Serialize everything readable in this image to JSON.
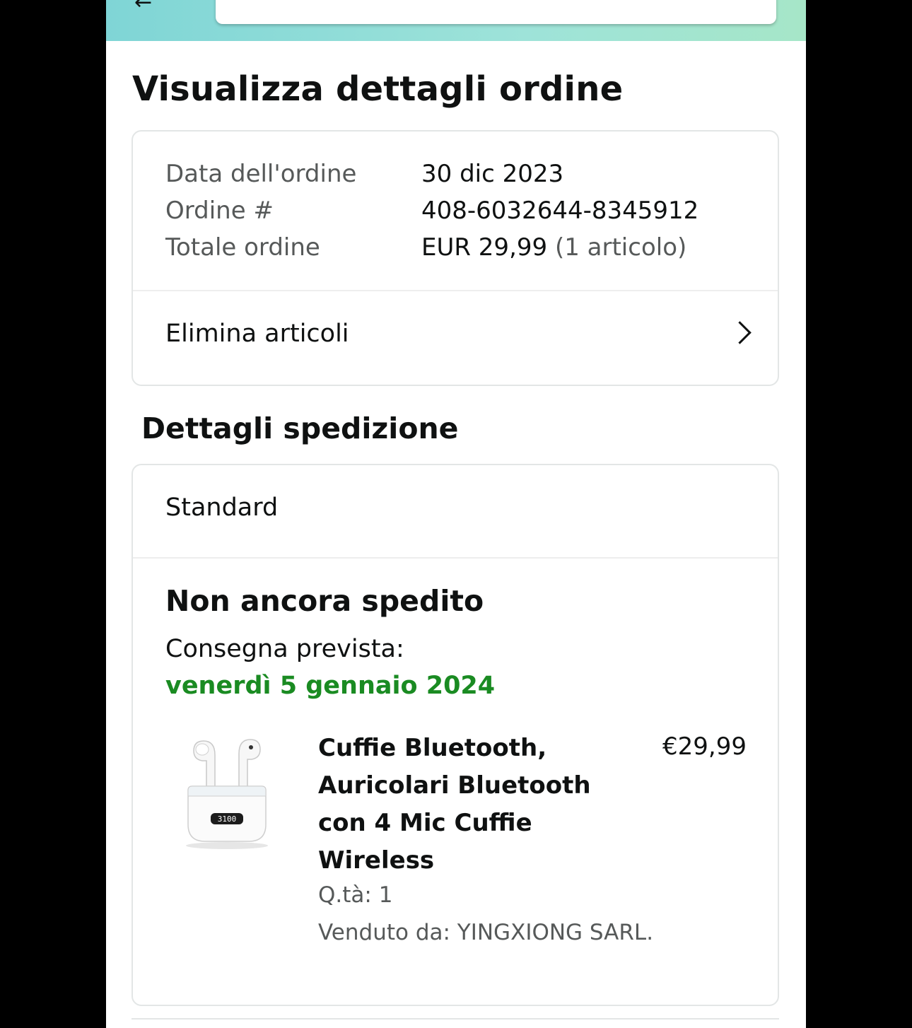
{
  "page": {
    "title": "Visualizza dettagli ordine"
  },
  "order_summary": {
    "rows": [
      {
        "label": "Data dell'ordine",
        "value": "30 dic 2023"
      },
      {
        "label": "Ordine #",
        "value": "408-6032644-8345912"
      },
      {
        "label": "Totale ordine",
        "value": "EUR 29,99",
        "value_extra": "(1 articolo)"
      }
    ],
    "action_label": "Elimina articoli"
  },
  "shipping": {
    "section_title": "Dettagli spedizione",
    "method": "Standard",
    "status": "Non ancora spedito",
    "delivery_label": "Consegna prevista:",
    "delivery_date": "venerdì 5 gennaio 2024",
    "item": {
      "title": "Cuffie Bluetooth, Auricolari Bluetooth con 4 Mic Cuffie Wireless",
      "price": "€29,99",
      "quantity": "Q.tà: 1",
      "seller": "Venduto da: YINGXIONG SARL.",
      "image_icon": "earbuds-product-icon",
      "case_display": "3100"
    }
  },
  "colors": {
    "header_gradient_start": "#7fd5d6",
    "header_gradient_end": "#a6e6c8",
    "delivery_date": "#1a8b22",
    "muted_text": "#565959",
    "card_border": "#e3e6e6"
  }
}
